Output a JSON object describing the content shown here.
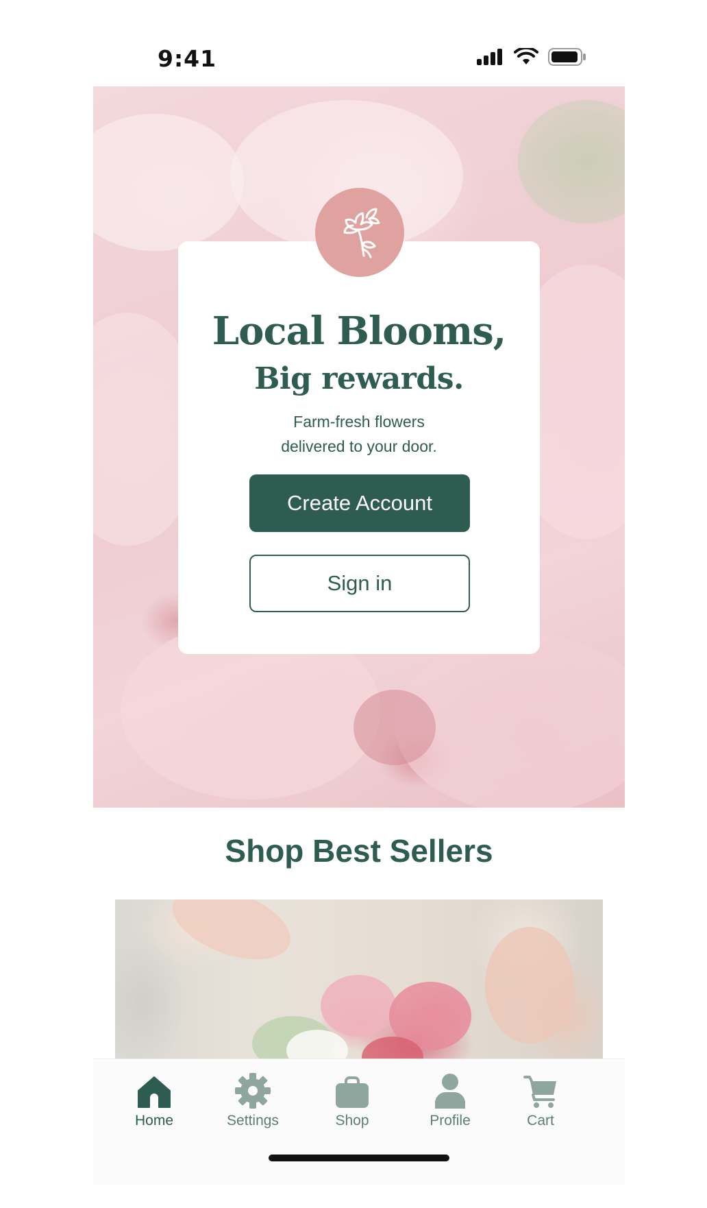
{
  "status_bar": {
    "time": "9:41",
    "icons": [
      "signal-icon",
      "wifi-icon",
      "battery-icon"
    ]
  },
  "hero": {
    "logo_icon": "flower-icon",
    "headline_line1": "Local Blooms,",
    "headline_line2": "Big rewards.",
    "tagline_line1": "Farm-fresh flowers",
    "tagline_line2": "delivered to your door.",
    "create_account_label": "Create Account",
    "sign_in_label": "Sign in"
  },
  "best_sellers": {
    "title": "Shop Best Sellers"
  },
  "tab_bar": {
    "items": [
      {
        "label": "Home",
        "icon": "home-icon",
        "active": true
      },
      {
        "label": "Settings",
        "icon": "gear-icon",
        "active": false
      },
      {
        "label": "Shop",
        "icon": "bag-icon",
        "active": false
      },
      {
        "label": "Profile",
        "icon": "profile-icon",
        "active": false
      },
      {
        "label": "Cart",
        "icon": "cart-icon",
        "active": false
      }
    ]
  },
  "colors": {
    "primary": "#2e5c50",
    "logo_circle": "#e0a29e",
    "inactive_tab": "#8fa69e",
    "background": "#ffffff"
  }
}
